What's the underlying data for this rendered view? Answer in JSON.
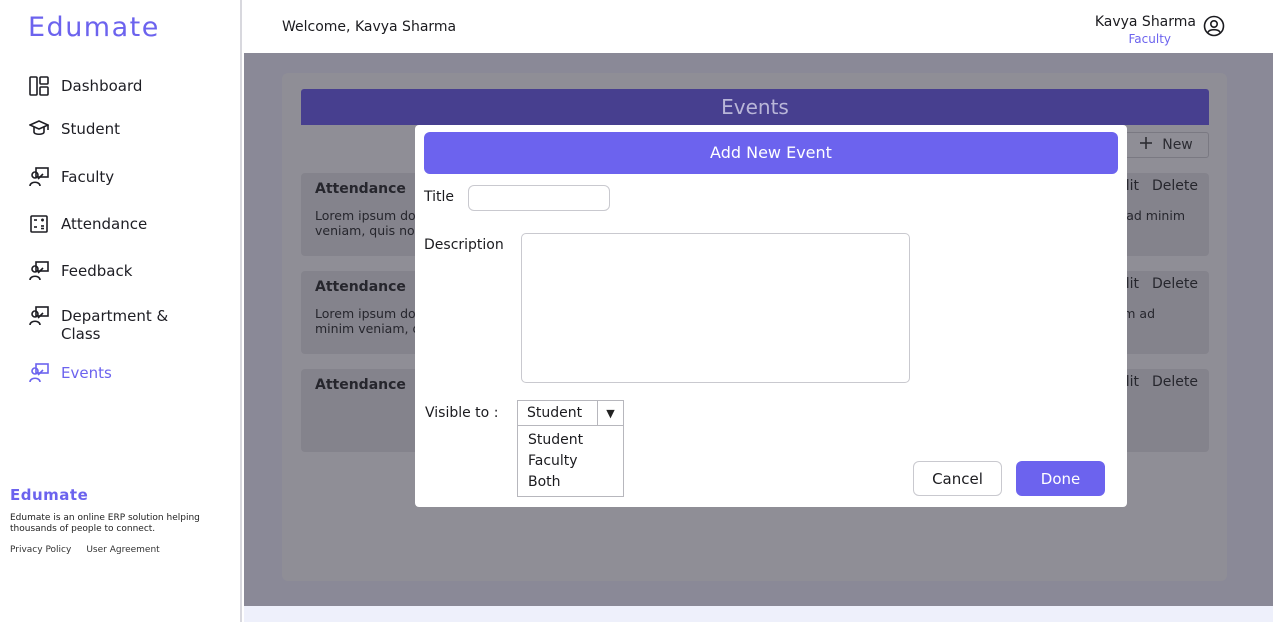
{
  "app": {
    "brand": "Edumate"
  },
  "sidebar": {
    "items": [
      {
        "label": "Dashboard",
        "icon": "dashboard-icon"
      },
      {
        "label": "Student",
        "icon": "graduation-cap-icon"
      },
      {
        "label": "Faculty",
        "icon": "teacher-icon"
      },
      {
        "label": "Attendance",
        "icon": "calculator-icon"
      },
      {
        "label": "Feedback",
        "icon": "teacher-icon"
      },
      {
        "label": "Department & Class",
        "icon": "teacher-icon"
      },
      {
        "label": "Events",
        "icon": "teacher-icon",
        "active": true
      }
    ],
    "footer": {
      "brand": "Edumate",
      "description": "Edumate is an online ERP solution helping thousands of people to connect.",
      "privacy": "Privacy Policy",
      "agreement": "User Agreement"
    }
  },
  "header": {
    "welcome": "Welcome, Kavya Sharma",
    "user_name": "Kavya Sharma",
    "user_role": "Faculty"
  },
  "events_page": {
    "title": "Events",
    "new_label": "New",
    "cards": [
      {
        "title": "Attendance",
        "desc_left": "Lorem ipsum do",
        "desc_left2": "veniam, quis nos",
        "desc_right": "im ad minim",
        "edit": "lit",
        "delete": "Delete"
      },
      {
        "title": "Attendance",
        "desc_left": "Lorem ipsum do",
        "desc_left2": "minim veniam, q",
        "desc_right": "nim ad",
        "edit": "lit",
        "delete": "Delete"
      },
      {
        "title": "Attendance",
        "desc_left": "",
        "desc_left2": "",
        "desc_right": "",
        "edit": "lit",
        "delete": "Delete"
      }
    ]
  },
  "modal": {
    "title": "Add New Event",
    "title_label": "Title",
    "title_value": "",
    "description_label": "Description",
    "description_value": "",
    "visible_label": "Visible to :",
    "visible_selected": "Student",
    "visible_options": [
      "Student",
      "Faculty",
      "Both"
    ],
    "cancel": "Cancel",
    "done": "Done"
  },
  "colors": {
    "accent": "#6c63ee",
    "overlay": "#8a8997",
    "events_header": "#473f8f"
  }
}
